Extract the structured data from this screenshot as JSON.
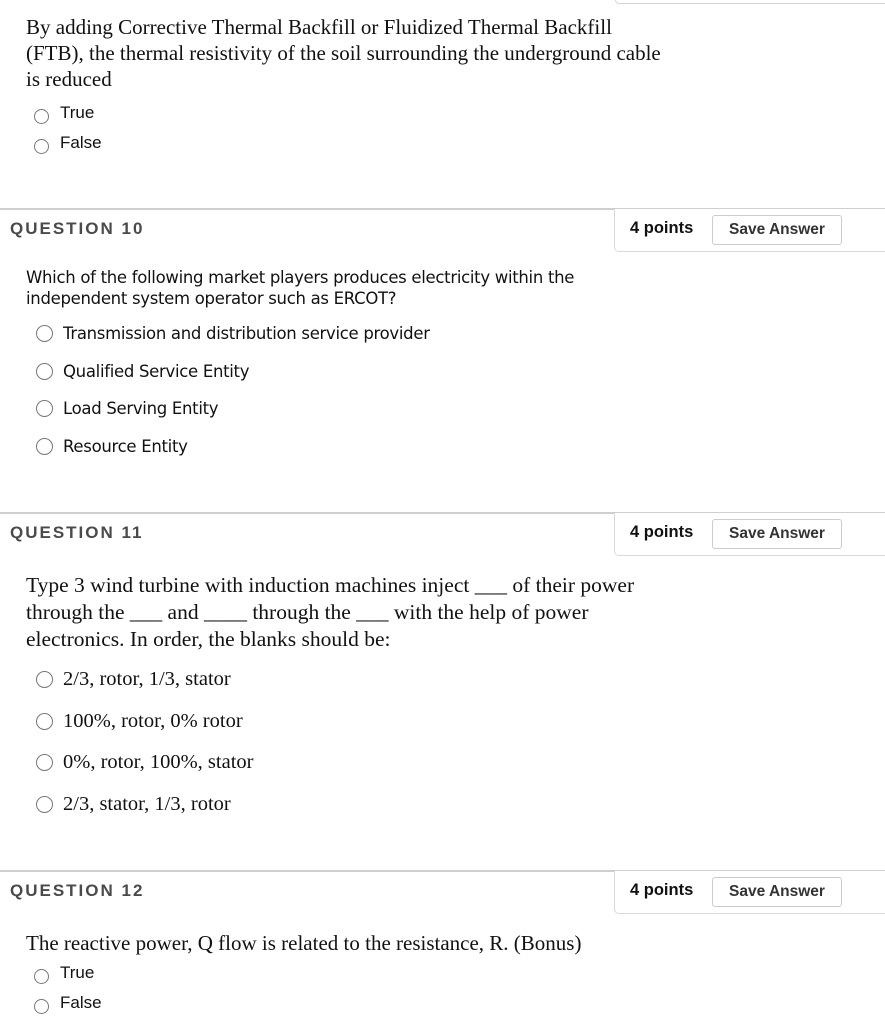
{
  "q9": {
    "text": "By adding Corrective Thermal Backfill or Fluidized Thermal Backfill (FTB), the thermal resistivity of the soil surrounding the underground cable is reduced",
    "options": [
      "True",
      "False"
    ]
  },
  "q10": {
    "title": "QUESTION 10",
    "points": "4 points",
    "save_label": "Save Answer",
    "text_line1": "Which of the following market players produces electricity within the",
    "text_line2": "independent system operator such as ERCOT?",
    "options": [
      "Transmission and distribution service provider",
      "Qualified Service Entity",
      "Load Serving Entity",
      "Resource Entity"
    ]
  },
  "q11": {
    "title": "QUESTION 11",
    "points": "4 points",
    "save_label": "Save Answer",
    "text_line1": "Type 3 wind turbine with induction machines inject ___ of their power",
    "text_line2": "through the ___ and ____ through the ___ with the help of power",
    "text_line3": "electronics. In order, the blanks should be:",
    "options": [
      "2/3, rotor, 1/3, stator",
      "100%, rotor, 0% rotor",
      "0%, rotor, 100%, stator",
      "2/3, stator, 1/3, rotor"
    ]
  },
  "q12": {
    "title": "QUESTION 12",
    "points": "4 points",
    "save_label": "Save Answer",
    "text": "The reactive power, Q flow is related to the resistance, R.  (Bonus)",
    "options": [
      "True",
      "False"
    ]
  }
}
